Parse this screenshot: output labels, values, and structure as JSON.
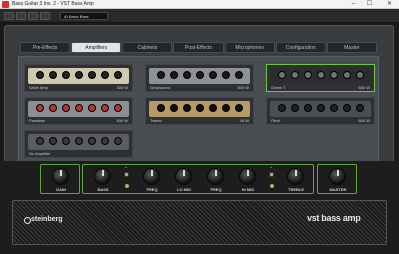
{
  "window": {
    "title": "Bass Guitar 3 Ins. 2 - VST Bass Amp",
    "minimize": "–",
    "maximize": "☐",
    "close": "✕"
  },
  "toolbar": {
    "preset": "AI Basic Bass"
  },
  "tabs": [
    {
      "label": "Pre-Effects",
      "active": false
    },
    {
      "label": "Amplifiers",
      "active": true
    },
    {
      "label": "Cabinets",
      "active": false
    },
    {
      "label": "Post-Effects",
      "active": false
    },
    {
      "label": "Microphones",
      "active": false
    },
    {
      "label": "Configuration",
      "active": false
    },
    {
      "label": "Master",
      "active": false
    }
  ],
  "amplifiers": [
    {
      "name": "Valve Amp",
      "power": "300 W",
      "selected": false,
      "face_color": "#cfc9b0",
      "knob_color": "#222"
    },
    {
      "name": "Greyhound",
      "power": "500 W",
      "selected": false,
      "face_color": "#8e9196",
      "knob_color": "#1a1a1a"
    },
    {
      "name": "Green T",
      "power": "600 W",
      "selected": true,
      "face_color": "#2b2d2f",
      "knob_color": "#6f7377"
    },
    {
      "name": "Paradise",
      "power": "500 W",
      "selected": false,
      "face_color": "#8a8f94",
      "knob_color": "#b33a2a"
    },
    {
      "name": "Tweed",
      "power": "45 W",
      "selected": false,
      "face_color": "#b89a66",
      "knob_color": "#111"
    },
    {
      "name": "iTech",
      "power": "600 W",
      "selected": false,
      "face_color": "#4a4f56",
      "knob_color": "#222"
    },
    {
      "name": "No Amplifier",
      "power": "",
      "selected": false,
      "face_color": "#5a5d61",
      "knob_color": "#3a3a3a"
    }
  ],
  "controls": {
    "gain": "GAIN",
    "bass": "BASS",
    "freq1": "FREQ",
    "lo_mid": "LO MID",
    "freq2": "FREQ",
    "hi_mid": "HI MID",
    "treble": "TREBLE",
    "master": "MASTER"
  },
  "brand": {
    "company": "steinberg",
    "product": "vst bass amp"
  },
  "colors": {
    "accent": "#6ec44a",
    "active_tab": "#e4e4e4"
  }
}
